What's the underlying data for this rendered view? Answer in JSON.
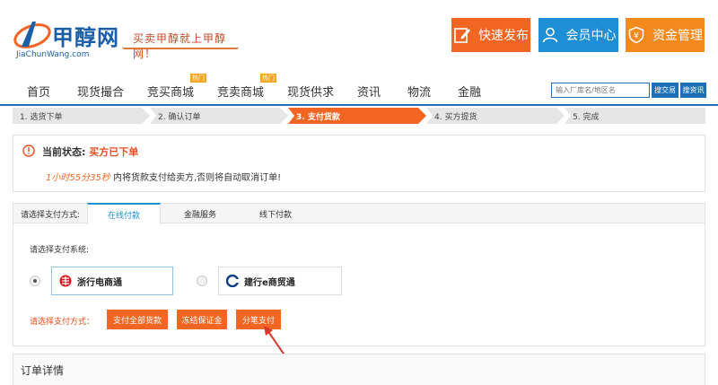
{
  "header": {
    "logo_cn": "甲醇网",
    "logo_en": "JiaChunWang.com",
    "slogan": "买卖甲醇就上甲醇网！",
    "buttons": [
      {
        "label": "快速发布",
        "icon": "edit-icon",
        "color": "#f26522"
      },
      {
        "label": "会员中心",
        "icon": "user-icon",
        "color": "#1e8fd6"
      },
      {
        "label": "资金管理",
        "icon": "yen-shield-icon",
        "color": "#f48a1e"
      }
    ]
  },
  "nav": {
    "items": [
      {
        "label": "首页"
      },
      {
        "label": "现货撮合"
      },
      {
        "label": "竞买商城",
        "badge": "热门"
      },
      {
        "label": "竞卖商城",
        "badge": "热门"
      },
      {
        "label": "现货供求"
      },
      {
        "label": "资讯"
      },
      {
        "label": "物流"
      },
      {
        "label": "金融"
      }
    ],
    "search": {
      "placeholder": "输入厂库名/地区名",
      "buttons": [
        "搜交易",
        "搜资讯"
      ]
    }
  },
  "steps": [
    {
      "label": "1. 选货下单",
      "active": false
    },
    {
      "label": "2. 确认订单",
      "active": false
    },
    {
      "label": "3. 支付货款",
      "active": true
    },
    {
      "label": "4. 买方提货",
      "active": false
    },
    {
      "label": "5. 完成",
      "active": false
    }
  ],
  "status": {
    "label": "当前状态:",
    "value": "买方已下单",
    "timer": "1小时55分35秒",
    "message": "内将货款支付给卖方,否则将自动取消订单!"
  },
  "payment": {
    "tabs_label": "请选择支付方式:",
    "tabs": [
      {
        "label": "在线付款",
        "active": true
      },
      {
        "label": "金融服务",
        "active": false
      },
      {
        "label": "线下付款",
        "active": false
      }
    ],
    "system_label": "请选择支付系统:",
    "banks": [
      {
        "name": "浙行电商通",
        "selected": true
      },
      {
        "name": "建行e商贸通",
        "selected": false
      }
    ],
    "method_label": "请选择支付方式：",
    "methods": [
      "支付全部货款",
      "冻结保证金",
      "分笔支付"
    ]
  },
  "order": {
    "title": "订单详情"
  }
}
